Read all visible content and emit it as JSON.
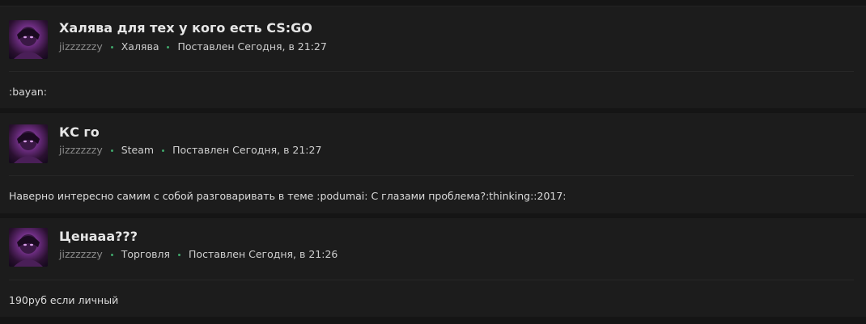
{
  "posts": [
    {
      "title": "Халява для тех у кого есть CS:GO",
      "author": "jizzzzzzy",
      "category": "Халява",
      "posted": "Поставлен Сегодня, в 21:27",
      "body": ":bayan:"
    },
    {
      "title": "КС го",
      "author": "jizzzzzzy",
      "category": "Steam",
      "posted": "Поставлен Сегодня, в 21:27",
      "body": "Наверно интересно самим с собой разговаривать в теме :podumai: С глазами проблема?:thinking::2017:"
    },
    {
      "title": "Ценааа???",
      "author": "jizzzzzzy",
      "category": "Торговля",
      "posted": "Поставлен Сегодня, в 21:26",
      "body": "190руб если личный"
    }
  ],
  "colors": {
    "background": "#1c1c1c",
    "separator": "#151515",
    "meta_dot": "#3fa66a",
    "avatar_accent": "#b068c4"
  }
}
